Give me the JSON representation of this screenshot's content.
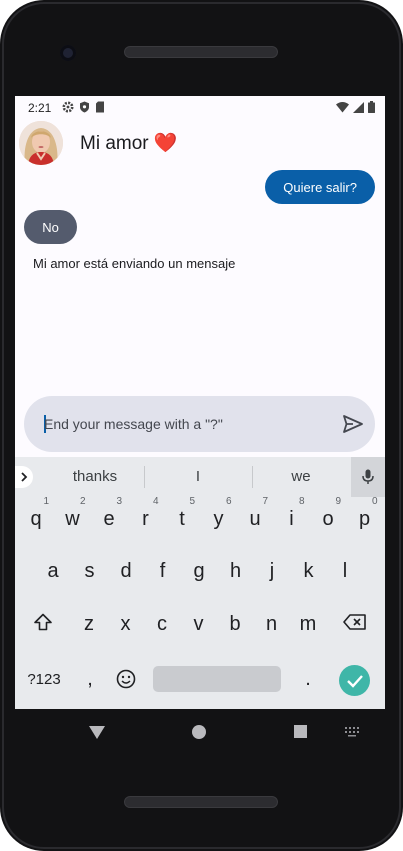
{
  "status": {
    "time": "2:21"
  },
  "chat": {
    "contact_name": "Mi amor ❤️",
    "messages": [
      {
        "from": "me",
        "text": "Quiere salir?"
      },
      {
        "from": "them",
        "text": "No"
      }
    ],
    "typing_text": "Mi amor está enviando un mensaje"
  },
  "composer": {
    "placeholder": "End your message with a \"?\""
  },
  "keyboard": {
    "suggestions": [
      "thanks",
      "I",
      "we"
    ],
    "row1": [
      {
        "k": "q",
        "n": "1"
      },
      {
        "k": "w",
        "n": "2"
      },
      {
        "k": "e",
        "n": "3"
      },
      {
        "k": "r",
        "n": "4"
      },
      {
        "k": "t",
        "n": "5"
      },
      {
        "k": "y",
        "n": "6"
      },
      {
        "k": "u",
        "n": "7"
      },
      {
        "k": "i",
        "n": "8"
      },
      {
        "k": "o",
        "n": "9"
      },
      {
        "k": "p",
        "n": "0"
      }
    ],
    "row2": [
      "a",
      "s",
      "d",
      "f",
      "g",
      "h",
      "j",
      "k",
      "l"
    ],
    "row3": [
      "z",
      "x",
      "c",
      "v",
      "b",
      "n",
      "m"
    ],
    "symbols_label": "?123",
    "comma": ",",
    "period": "."
  },
  "icons": [
    "settings-icon",
    "shield-icon",
    "sd-card-icon",
    "wifi-icon",
    "signal-icon",
    "battery-icon",
    "send-icon",
    "chevron-right-icon",
    "mic-icon",
    "shift-icon",
    "backspace-icon",
    "emoji-icon",
    "check-icon",
    "back-triangle-icon",
    "home-circle-icon",
    "recents-square-icon",
    "keyboard-switch-icon"
  ],
  "colors": {
    "accent": "#0a5fa8",
    "incoming_bubble": "#545b6d",
    "composer_bg": "#e1e2ec",
    "enter_key": "#3fb6a8"
  }
}
